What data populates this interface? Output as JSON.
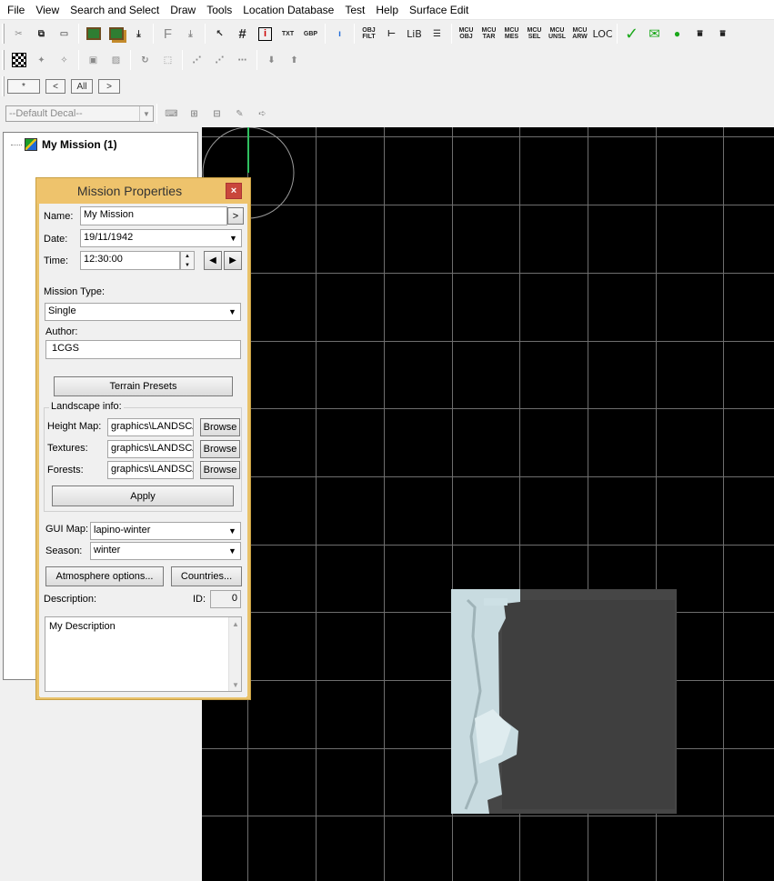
{
  "menu": [
    "File",
    "View",
    "Search and Select",
    "Draw",
    "Tools",
    "Location Database",
    "Test",
    "Help",
    "Surface Edit"
  ],
  "toolbar": {
    "txt_label": "TXT",
    "gbp_label": "GBP",
    "obj_filt_label": "OBJ FILT",
    "lib_label": "LiB",
    "mcu_obj": "MCU OBJ",
    "mcu_tar": "MCU TAR",
    "mcu_mes": "MCU MES",
    "mcu_sel": "MCU SEL",
    "mcu_unsl": "MCU UNSL",
    "mcu_arw": "MCU ARW",
    "loc_label": "LOC"
  },
  "filter": {
    "star": "*",
    "prev": "<",
    "all": "All",
    "next": ">"
  },
  "decal": {
    "selected": "--Default Decal--"
  },
  "tree": {
    "root_label": "My Mission (1)"
  },
  "dialog": {
    "title": "Mission Properties",
    "close": "×",
    "name_label": "Name:",
    "name_value": "My Mission",
    "name_btn": ">",
    "date_label": "Date:",
    "date_value": "19/11/1942",
    "time_label": "Time:",
    "time_value": "12:30:00",
    "mission_type_label": "Mission Type:",
    "mission_type_value": "Single",
    "author_label": "Author:",
    "author_value": "1CGS",
    "terrain_presets": "Terrain Presets",
    "landscape_group": "Landscape info:",
    "height_map_label": "Height Map:",
    "height_map_value": "graphics\\LANDSCA",
    "textures_label": "Textures:",
    "textures_value": "graphics\\LANDSCA",
    "forests_label": "Forests:",
    "forests_value": "graphics\\LANDSCA",
    "browse": "Browse",
    "apply": "Apply",
    "gui_map_label": "GUI Map:",
    "gui_map_value": "lapino-winter",
    "season_label": "Season:",
    "season_value": "winter",
    "atmosphere_btn": "Atmosphere options...",
    "countries_btn": "Countries...",
    "description_label": "Description:",
    "id_label": "ID:",
    "id_value": "0",
    "description_value": "My Description"
  },
  "colors": {
    "dialog_title": "#eec36c",
    "map_bg": "#000000",
    "grid": "#6e6e6e",
    "accent_green": "#1aa81a"
  }
}
